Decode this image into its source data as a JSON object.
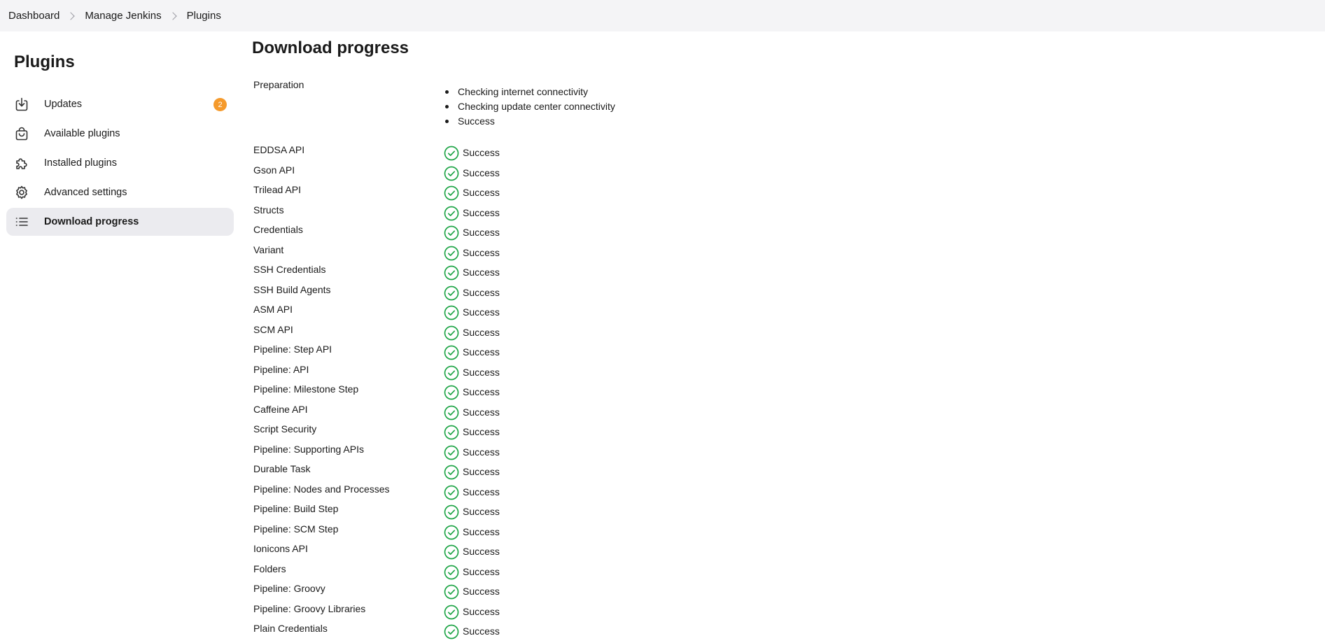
{
  "breadcrumb": [
    "Dashboard",
    "Manage Jenkins",
    "Plugins"
  ],
  "sidebar": {
    "title": "Plugins",
    "items": [
      {
        "label": "Updates",
        "icon": "download-icon",
        "badge": "2"
      },
      {
        "label": "Available plugins",
        "icon": "shopping-bag-icon"
      },
      {
        "label": "Installed plugins",
        "icon": "puzzle-icon"
      },
      {
        "label": "Advanced settings",
        "icon": "gear-icon"
      },
      {
        "label": "Download progress",
        "icon": "list-icon",
        "active": true
      }
    ]
  },
  "main": {
    "title": "Download progress",
    "preparation": {
      "label": "Preparation",
      "steps": [
        "Checking internet connectivity",
        "Checking update center connectivity",
        "Success"
      ]
    },
    "plugins": [
      {
        "name": "EDDSA API",
        "status": "Success"
      },
      {
        "name": "Gson API",
        "status": "Success"
      },
      {
        "name": "Trilead API",
        "status": "Success"
      },
      {
        "name": "Structs",
        "status": "Success"
      },
      {
        "name": "Credentials",
        "status": "Success"
      },
      {
        "name": "Variant",
        "status": "Success"
      },
      {
        "name": "SSH Credentials",
        "status": "Success"
      },
      {
        "name": "SSH Build Agents",
        "status": "Success"
      },
      {
        "name": "ASM API",
        "status": "Success"
      },
      {
        "name": "SCM API",
        "status": "Success"
      },
      {
        "name": "Pipeline: Step API",
        "status": "Success"
      },
      {
        "name": "Pipeline: API",
        "status": "Success"
      },
      {
        "name": "Pipeline: Milestone Step",
        "status": "Success"
      },
      {
        "name": "Caffeine API",
        "status": "Success"
      },
      {
        "name": "Script Security",
        "status": "Success"
      },
      {
        "name": "Pipeline: Supporting APIs",
        "status": "Success"
      },
      {
        "name": "Durable Task",
        "status": "Success"
      },
      {
        "name": "Pipeline: Nodes and Processes",
        "status": "Success"
      },
      {
        "name": "Pipeline: Build Step",
        "status": "Success"
      },
      {
        "name": "Pipeline: SCM Step",
        "status": "Success"
      },
      {
        "name": "Ionicons API",
        "status": "Success"
      },
      {
        "name": "Folders",
        "status": "Success"
      },
      {
        "name": "Pipeline: Groovy",
        "status": "Success"
      },
      {
        "name": "Pipeline: Groovy Libraries",
        "status": "Success"
      },
      {
        "name": "Plain Credentials",
        "status": "Success"
      }
    ]
  },
  "colors": {
    "success": "#1ea446",
    "badge": "#f59a2c",
    "active_bg": "#ebebef",
    "topbar_bg": "#f4f4f6"
  }
}
